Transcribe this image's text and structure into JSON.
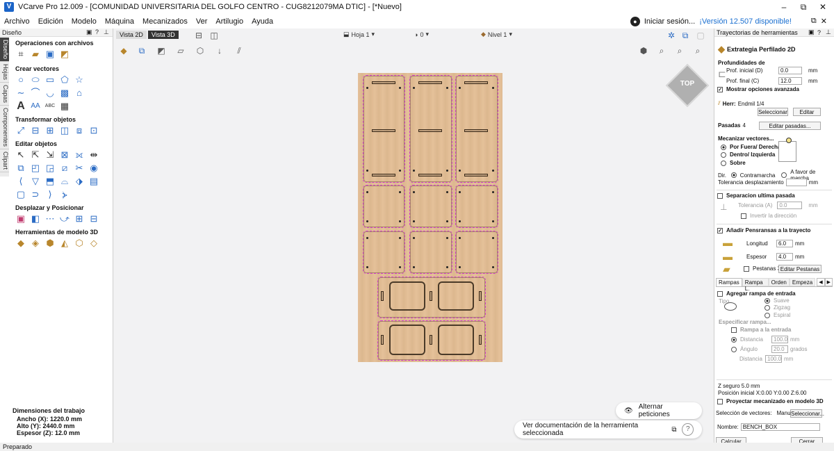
{
  "window": {
    "title": "VCarve Pro 12.009 - [COMUNIDAD UNIVERSITARIA DEL GOLFO CENTRO - CUG8212079MA DTIC] - [*Nuevo]",
    "minimize": "–",
    "maximize": "⧉",
    "close": "✕"
  },
  "menu": {
    "items": [
      "Archivo",
      "Edición",
      "Modelo",
      "Máquina",
      "Mecanizados",
      "Ver",
      "Artilugio",
      "Ayuda"
    ],
    "signin": "Iniciar sesión...",
    "update": "¡Versión 12.507 disponible!",
    "max": "⧉",
    "close": "✕"
  },
  "left_panel": {
    "header": "Diseño",
    "vtabs": [
      "Diseño",
      "Hojas",
      "Capas",
      "Componentes",
      "Clipart"
    ],
    "sections": [
      {
        "title": "Operaciones con archivos"
      },
      {
        "title": "Crear vectores"
      },
      {
        "title": "Transformar objetos"
      },
      {
        "title": "Editar objetos"
      },
      {
        "title": "Desplazar y Posicionar"
      },
      {
        "title": "Herramientas de modelo 3D"
      }
    ],
    "dims": {
      "title": "Dimensiones del trabajo",
      "width": "Ancho  (X): 1220.0 mm",
      "height": "Alto   (Y): 2440.0 mm",
      "thick": "Espesor (Z): 12.0 mm"
    }
  },
  "center": {
    "tab2d": "Vista 2D",
    "tab3d": "Vista 3D",
    "sheet": "Hoja 1",
    "zero": "0",
    "level": "Nivel 1",
    "cube_label": "TOP",
    "toggle_label": "Alternar peticiones",
    "doc_label": "Ver documentación de la herramienta seleccionada",
    "help": "?"
  },
  "right_panel": {
    "header": "Trayectorias de herramientas",
    "strategy": "Extrategia Perfilado 2D",
    "depths_title": "Profundidades de",
    "start_label": "Prof. inicial (D)",
    "start_val": "0.0",
    "end_label": "Prof. final (C)",
    "end_val": "12.0",
    "unit": "mm",
    "advanced": "Mostrar opciones avanzada",
    "tool_label": "Herr:",
    "tool_name": "Endmil 1/4",
    "select_btn": "Seleccionar",
    "edit_btn": "Editar",
    "passes_label": "Pasadas",
    "passes_val": "4",
    "edit_passes_btn": "Editar pasadas...",
    "machine_title": "Mecanizar vectores...",
    "outside": "Por Fuera/ Derecha",
    "inside": "Dentro/ Izquierda",
    "on": "Sobre",
    "dir_label": "Dir.",
    "climb": "Contramarcha",
    "conventional": "A favor de marcha",
    "offset_label": "Tolerancia desplazamiento",
    "last_pass": "Separacion ultima pasada",
    "tolerance_label": "Tolerancia (A)",
    "tolerance_val": "0.0",
    "reverse": "Invertir la dirección",
    "tabs_title": "Añadir Pensransas a la trayecto",
    "length_label": "Longitud",
    "length_val": "6.0",
    "thick_label": "Espesor",
    "thick_val": "4.0",
    "tabs3d": "Pestanas 3D",
    "edit_tabs_btn": "Editar Pestanas ...",
    "subtabs": [
      "Rampas",
      "Rampa L.",
      "Orden",
      "Empeza"
    ],
    "ramp_add": "Agregar rampa de entrada",
    "type_label": "Tipo",
    "smooth": "Suave",
    "zigzag": "Zigzag",
    "spiral": "Espiral",
    "specify": "Especificar rampa...",
    "ramp_entry": "Rampa a la entrada",
    "distance_label": "Distancia",
    "distance_val": "100.0",
    "angle_label": "Ángulo",
    "angle_val": "20.0",
    "degrees": "grados",
    "distance2_val": "100.0",
    "zsafe": "Z seguro        5.0 mm",
    "home": "Posición inicial   X:0.00 Y:0.00 Z:6.00",
    "project3d": "Proyectar mecanizado en modelo 3D",
    "vecsel_label": "Selección de vectores:",
    "vecsel_val": "Manual",
    "vecsel_btn": "Seleccionar...",
    "name_label": "Nombre:",
    "name_val": "BENCH_BOX",
    "calc_btn": "Calcular",
    "close_btn": "Cerrar"
  },
  "status": "Preparado"
}
